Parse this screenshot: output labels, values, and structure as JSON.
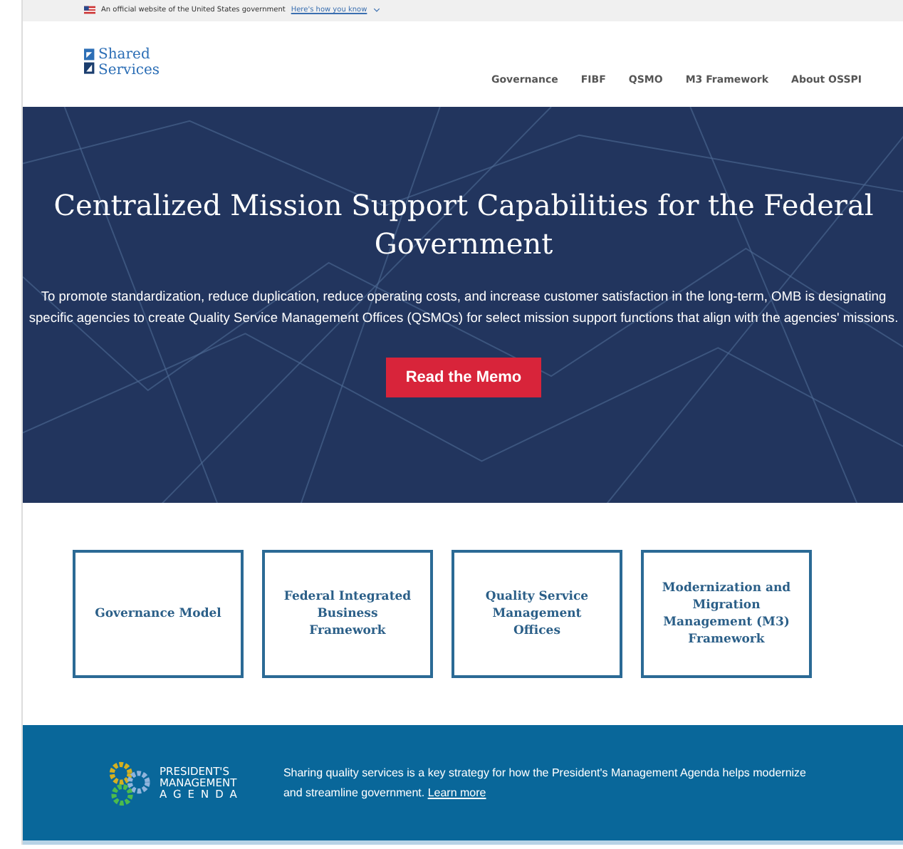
{
  "gov_banner": {
    "text": "An official website of the United States government",
    "link": "Here's how you know"
  },
  "logo": {
    "line_1": "Shared",
    "line_2": "Services"
  },
  "nav": [
    {
      "label": "Governance"
    },
    {
      "label": "FIBF"
    },
    {
      "label": "QSMO"
    },
    {
      "label": "M3 Framework"
    },
    {
      "label": "About OSSPI"
    }
  ],
  "hero": {
    "title": "Centralized Mission Support Capabilities for the Federal Government",
    "text": "To promote standardization, reduce duplication, reduce operating costs, and increase customer satisfaction in the long-term, OMB is designating specific agencies to create Quality Service Management Offices (QSMOs) for select mission support functions that align with the agencies' missions.",
    "button": "Read the Memo"
  },
  "cards": [
    {
      "label": "Governance Model"
    },
    {
      "label": "Federal Integrated Business Framework"
    },
    {
      "label": "Quality Service Management Offices"
    },
    {
      "label": "Modernization and Migration Management (M3) Framework"
    }
  ],
  "footer": {
    "logo_lines": [
      "PRESIDENT'S",
      "MANAGEMENT",
      "AGENDA"
    ],
    "text": "Sharing quality services is a key strategy for how the President's Management Agenda helps modernize and streamline government.",
    "link": "Learn more"
  }
}
